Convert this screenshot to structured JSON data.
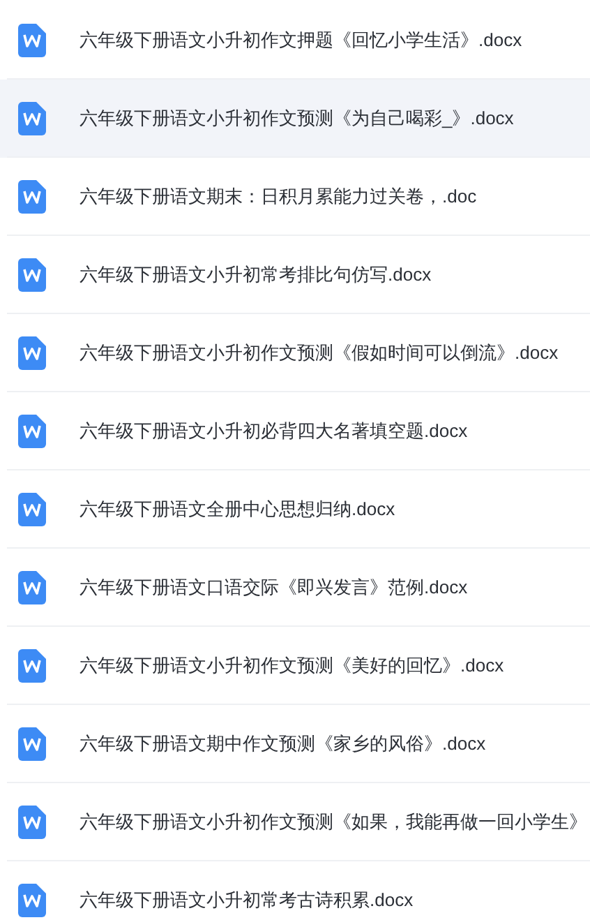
{
  "files": [
    {
      "name": "六年级下册语文小升初作文押题《回忆小学生活》.docx",
      "selected": false
    },
    {
      "name": "六年级下册语文小升初作文预测《为自己喝彩_》.docx",
      "selected": true
    },
    {
      "name": "六年级下册语文期末：日积月累能力过关卷，.doc",
      "selected": false
    },
    {
      "name": "六年级下册语文小升初常考排比句仿写.docx",
      "selected": false
    },
    {
      "name": "六年级下册语文小升初作文预测《假如时间可以倒流》.docx",
      "selected": false
    },
    {
      "name": "六年级下册语文小升初必背四大名著填空题.docx",
      "selected": false
    },
    {
      "name": "六年级下册语文全册中心思想归纳.docx",
      "selected": false
    },
    {
      "name": "六年级下册语文口语交际《即兴发言》范例.docx",
      "selected": false
    },
    {
      "name": "六年级下册语文小升初作文预测《美好的回忆》.docx",
      "selected": false
    },
    {
      "name": "六年级下册语文期中作文预测《家乡的风俗》.docx",
      "selected": false
    },
    {
      "name": "六年级下册语文小升初作文预测《如果，我能再做一回小学生》",
      "selected": false
    },
    {
      "name": "六年级下册语文小升初常考古诗积累.docx",
      "selected": false
    }
  ]
}
